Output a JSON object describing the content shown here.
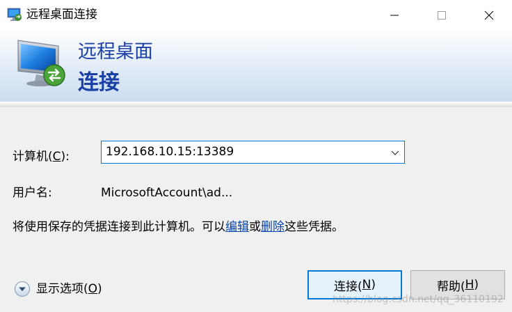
{
  "window": {
    "title": "远程桌面连接",
    "title_icon": "remote-desktop-icon"
  },
  "banner": {
    "line1": "远程桌面",
    "line2": "连接",
    "icon": "remote-desktop-monitor-icon"
  },
  "form": {
    "computer_label_prefix": "计算机(",
    "computer_label_key": "C",
    "computer_label_suffix": "):",
    "computer_value": "192.168.10.15:13389",
    "user_label": "用户名:",
    "user_value": "MicrosoftAccount\\ad..."
  },
  "info": {
    "text_before": "将使用保存的凭据连接到此计算机。可以",
    "link_edit": "编辑",
    "text_middle": "或",
    "link_delete": "删除",
    "text_after": "这些凭据。"
  },
  "options": {
    "label_prefix": "显示选项(",
    "label_key": "O",
    "label_suffix": ")"
  },
  "buttons": {
    "connect_prefix": "连接(",
    "connect_key": "N",
    "connect_suffix": ")",
    "help_prefix": "帮助(",
    "help_key": "H",
    "help_suffix": ")"
  },
  "watermark": "https://blog.csdn.net/qq_36110192",
  "colors": {
    "accent": "#0078d7",
    "banner_text": "#1a3fa5",
    "link": "#0645ad"
  }
}
